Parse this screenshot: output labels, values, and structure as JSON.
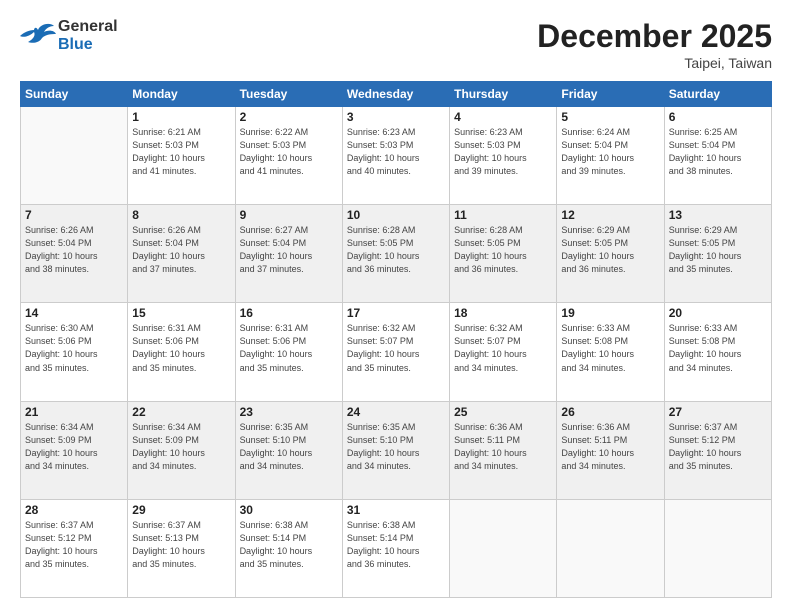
{
  "header": {
    "logo_line1": "General",
    "logo_line2": "Blue",
    "main_title": "December 2025",
    "sub_title": "Taipei, Taiwan"
  },
  "weekdays": [
    "Sunday",
    "Monday",
    "Tuesday",
    "Wednesday",
    "Thursday",
    "Friday",
    "Saturday"
  ],
  "weeks": [
    [
      {
        "day": "",
        "info": ""
      },
      {
        "day": "1",
        "info": "Sunrise: 6:21 AM\nSunset: 5:03 PM\nDaylight: 10 hours\nand 41 minutes."
      },
      {
        "day": "2",
        "info": "Sunrise: 6:22 AM\nSunset: 5:03 PM\nDaylight: 10 hours\nand 41 minutes."
      },
      {
        "day": "3",
        "info": "Sunrise: 6:23 AM\nSunset: 5:03 PM\nDaylight: 10 hours\nand 40 minutes."
      },
      {
        "day": "4",
        "info": "Sunrise: 6:23 AM\nSunset: 5:03 PM\nDaylight: 10 hours\nand 39 minutes."
      },
      {
        "day": "5",
        "info": "Sunrise: 6:24 AM\nSunset: 5:04 PM\nDaylight: 10 hours\nand 39 minutes."
      },
      {
        "day": "6",
        "info": "Sunrise: 6:25 AM\nSunset: 5:04 PM\nDaylight: 10 hours\nand 38 minutes."
      }
    ],
    [
      {
        "day": "7",
        "info": "Sunrise: 6:26 AM\nSunset: 5:04 PM\nDaylight: 10 hours\nand 38 minutes."
      },
      {
        "day": "8",
        "info": "Sunrise: 6:26 AM\nSunset: 5:04 PM\nDaylight: 10 hours\nand 37 minutes."
      },
      {
        "day": "9",
        "info": "Sunrise: 6:27 AM\nSunset: 5:04 PM\nDaylight: 10 hours\nand 37 minutes."
      },
      {
        "day": "10",
        "info": "Sunrise: 6:28 AM\nSunset: 5:05 PM\nDaylight: 10 hours\nand 36 minutes."
      },
      {
        "day": "11",
        "info": "Sunrise: 6:28 AM\nSunset: 5:05 PM\nDaylight: 10 hours\nand 36 minutes."
      },
      {
        "day": "12",
        "info": "Sunrise: 6:29 AM\nSunset: 5:05 PM\nDaylight: 10 hours\nand 36 minutes."
      },
      {
        "day": "13",
        "info": "Sunrise: 6:29 AM\nSunset: 5:05 PM\nDaylight: 10 hours\nand 35 minutes."
      }
    ],
    [
      {
        "day": "14",
        "info": "Sunrise: 6:30 AM\nSunset: 5:06 PM\nDaylight: 10 hours\nand 35 minutes."
      },
      {
        "day": "15",
        "info": "Sunrise: 6:31 AM\nSunset: 5:06 PM\nDaylight: 10 hours\nand 35 minutes."
      },
      {
        "day": "16",
        "info": "Sunrise: 6:31 AM\nSunset: 5:06 PM\nDaylight: 10 hours\nand 35 minutes."
      },
      {
        "day": "17",
        "info": "Sunrise: 6:32 AM\nSunset: 5:07 PM\nDaylight: 10 hours\nand 35 minutes."
      },
      {
        "day": "18",
        "info": "Sunrise: 6:32 AM\nSunset: 5:07 PM\nDaylight: 10 hours\nand 34 minutes."
      },
      {
        "day": "19",
        "info": "Sunrise: 6:33 AM\nSunset: 5:08 PM\nDaylight: 10 hours\nand 34 minutes."
      },
      {
        "day": "20",
        "info": "Sunrise: 6:33 AM\nSunset: 5:08 PM\nDaylight: 10 hours\nand 34 minutes."
      }
    ],
    [
      {
        "day": "21",
        "info": "Sunrise: 6:34 AM\nSunset: 5:09 PM\nDaylight: 10 hours\nand 34 minutes."
      },
      {
        "day": "22",
        "info": "Sunrise: 6:34 AM\nSunset: 5:09 PM\nDaylight: 10 hours\nand 34 minutes."
      },
      {
        "day": "23",
        "info": "Sunrise: 6:35 AM\nSunset: 5:10 PM\nDaylight: 10 hours\nand 34 minutes."
      },
      {
        "day": "24",
        "info": "Sunrise: 6:35 AM\nSunset: 5:10 PM\nDaylight: 10 hours\nand 34 minutes."
      },
      {
        "day": "25",
        "info": "Sunrise: 6:36 AM\nSunset: 5:11 PM\nDaylight: 10 hours\nand 34 minutes."
      },
      {
        "day": "26",
        "info": "Sunrise: 6:36 AM\nSunset: 5:11 PM\nDaylight: 10 hours\nand 34 minutes."
      },
      {
        "day": "27",
        "info": "Sunrise: 6:37 AM\nSunset: 5:12 PM\nDaylight: 10 hours\nand 35 minutes."
      }
    ],
    [
      {
        "day": "28",
        "info": "Sunrise: 6:37 AM\nSunset: 5:12 PM\nDaylight: 10 hours\nand 35 minutes."
      },
      {
        "day": "29",
        "info": "Sunrise: 6:37 AM\nSunset: 5:13 PM\nDaylight: 10 hours\nand 35 minutes."
      },
      {
        "day": "30",
        "info": "Sunrise: 6:38 AM\nSunset: 5:14 PM\nDaylight: 10 hours\nand 35 minutes."
      },
      {
        "day": "31",
        "info": "Sunrise: 6:38 AM\nSunset: 5:14 PM\nDaylight: 10 hours\nand 36 minutes."
      },
      {
        "day": "",
        "info": ""
      },
      {
        "day": "",
        "info": ""
      },
      {
        "day": "",
        "info": ""
      }
    ]
  ]
}
